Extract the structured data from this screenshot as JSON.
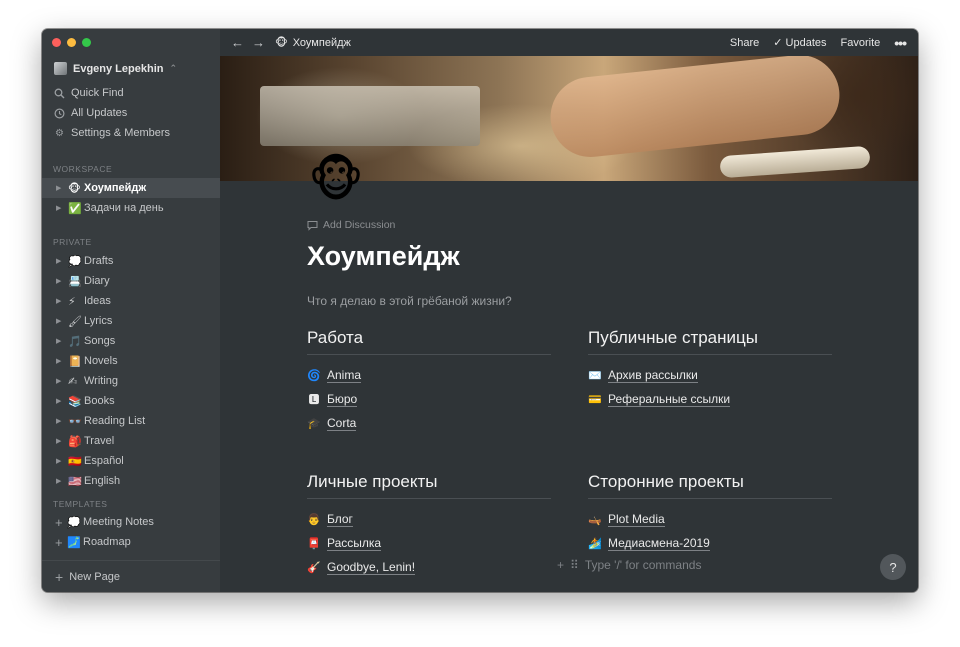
{
  "sidebar": {
    "workspace_name": "Evgeny Lepekhin",
    "menu": [
      {
        "label": "Quick Find",
        "icon": "search-icon"
      },
      {
        "label": "All Updates",
        "icon": "clock-icon"
      },
      {
        "label": "Settings & Members",
        "icon": "gear-icon"
      }
    ],
    "workspace_label": "WORKSPACE",
    "workspace_pages": [
      {
        "emoji": "🐵",
        "label": "Хоумпейдж"
      },
      {
        "emoji": "✅",
        "label": "Задачи на день"
      }
    ],
    "private_label": "PRIVATE",
    "private_pages": [
      {
        "emoji": "💭",
        "label": "Drafts"
      },
      {
        "emoji": "📇",
        "label": "Diary"
      },
      {
        "emoji": "⚡",
        "label": "Ideas"
      },
      {
        "emoji": "🖌",
        "label": "Lyrics"
      },
      {
        "emoji": "🎵",
        "label": "Songs"
      },
      {
        "emoji": "📔",
        "label": "Novels"
      },
      {
        "emoji": "✍",
        "label": "Writing"
      },
      {
        "emoji": "📚",
        "label": "Books"
      },
      {
        "emoji": "👓",
        "label": "Reading List"
      },
      {
        "emoji": "🎒",
        "label": "Travel"
      },
      {
        "emoji": "🇪🇸",
        "label": "Español"
      },
      {
        "emoji": "🇺🇸",
        "label": "English"
      }
    ],
    "templates_label": "TEMPLATES",
    "templates": [
      {
        "emoji": "💭",
        "label": "Meeting Notes"
      },
      {
        "emoji": "🗾",
        "label": "Roadmap"
      }
    ],
    "new_page_label": "New Page"
  },
  "topbar": {
    "breadcrumb_emoji": "🐵",
    "breadcrumb_title": "Хоумпейдж",
    "share_label": "Share",
    "updates_label": "Updates",
    "favorite_label": "Favorite",
    "more_label": "•••"
  },
  "page": {
    "icon_emoji": "🐵",
    "add_discussion_label": "Add Discussion",
    "title": "Хоумпейдж",
    "subtitle": "Что я делаю в этой грёбаной жизни?",
    "sections": [
      {
        "heading": "Работа",
        "links": [
          {
            "emoji": "🌀",
            "label": "Anima"
          },
          {
            "emoji": "🅻",
            "label": "Бюро"
          },
          {
            "emoji": "🎓",
            "label": "Corta"
          }
        ]
      },
      {
        "heading": "Публичные страницы",
        "links": [
          {
            "emoji": "✉️",
            "label": "Архив рассылки"
          },
          {
            "emoji": "💳",
            "label": "Реферальные ссылки"
          }
        ]
      },
      {
        "heading": "Личные проекты",
        "links": [
          {
            "emoji": "👨",
            "label": "Блог"
          },
          {
            "emoji": "📮",
            "label": "Рассылка"
          },
          {
            "emoji": "🎸",
            "label": "Goodbye, Lenin!"
          }
        ]
      },
      {
        "heading": "Сторонние проекты",
        "links": [
          {
            "emoji": "🛶",
            "label": "Plot Media"
          },
          {
            "emoji": "🏄",
            "label": "Медиасмена-2019"
          }
        ]
      }
    ],
    "command_placeholder": "Type '/' for commands",
    "help_label": "?"
  }
}
